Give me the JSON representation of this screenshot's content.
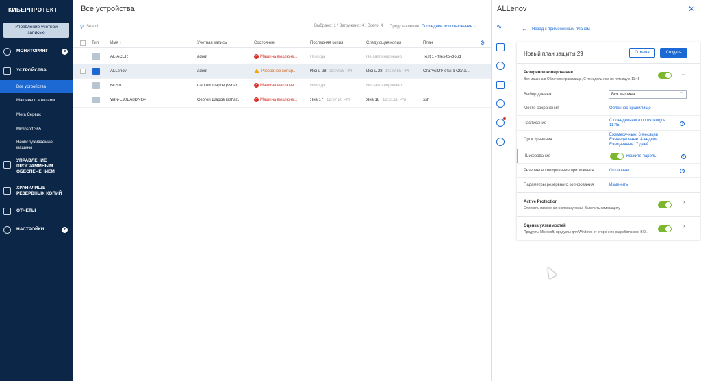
{
  "sidebar": {
    "logo": "КИБЕРПРОТЕКТ",
    "account_button": "Управление учетной\nзаписью",
    "nav": [
      {
        "label": "МОНИТОРИНГ",
        "badge": "5"
      },
      {
        "label": "УСТРОЙСТВА"
      },
      {
        "label": "УПРАВЛЕНИЕ\nПРОГРАММНЫМ\nОБЕСПЕЧЕНИЕМ"
      },
      {
        "label": "ХРАНИЛИЩЕ\nРЕЗЕРВНЫХ КОПИЙ"
      },
      {
        "label": "ОТЧЕТЫ"
      },
      {
        "label": "НАСТРОЙКИ",
        "badge": "+"
      }
    ],
    "sub_items": [
      {
        "label": "Все устройства"
      },
      {
        "label": "Машины с агентами"
      },
      {
        "label": "Мега Сервис"
      },
      {
        "label": "Microsoft 365"
      },
      {
        "label": "Необслуживаемые\nмашины"
      }
    ]
  },
  "main": {
    "title": "Все устройства",
    "search_placeholder": "Search",
    "counts": "Выбрано: 1 / Загружено: 4 / Всего: 4",
    "view_label": "Представление:",
    "view_value": "Последнее использование ⌄",
    "columns": [
      "Тип",
      "Имя ↑",
      "Учетная запись",
      "Состояние",
      "Последняя копия",
      "Следующая копия",
      "План"
    ],
    "rows": [
      {
        "name": "AL-ACER",
        "account": "adout",
        "status": "Машина выключе...",
        "last": "Никогда",
        "last_time": "",
        "next": "Не запланировано",
        "next_time": "",
        "plan": "Test 1 - files-to-cloud"
      },
      {
        "name": "ALLenov",
        "account": "adout",
        "status": "Резервное копир...",
        "last": "Июнь 28",
        "last_time": "09:09:35 PM",
        "next": "Июнь 28",
        "next_time": "10:23:55 PM",
        "plan": "Статус:Отчёты в Обла..."
      },
      {
        "name": "Bk201",
        "account": "Сергей Шаров (sshar...",
        "status": "Машина выключе...",
        "last": "Никогда",
        "last_time": "",
        "next": "Не запланировано",
        "next_time": "",
        "plan": ""
      },
      {
        "name": "WIN-E90EA8DNGP",
        "account": "Сергей Шаров (sshar...",
        "status": "Машина выключе...",
        "last": "Янв 17",
        "last_time": "12:37:20 PM",
        "next": "Янв 18",
        "next_time": "12:31:28 PM",
        "plan": "ssh"
      }
    ]
  },
  "panel": {
    "title": "ALLenov",
    "back_link": "Назад к примененным планам",
    "plan_name": "Новый план защиты 29",
    "cancel": "Отмена",
    "create": "Создать",
    "backup": {
      "title": "Резервное копирование",
      "subtitle": "Вся машина в Облачное хранилище, С понедельника по пятницу в 11:45"
    },
    "rows": [
      {
        "label": "Выбор данных",
        "value": "Вся машина"
      },
      {
        "label": "Место сохранения",
        "value": "Облачное хранилище"
      },
      {
        "label": "Расписание",
        "value": "С понедельника по пятницу в 11:45"
      },
      {
        "label": "Срок хранения",
        "value": "Ежемесячные: 6 месяцев\nЕженедельные: 4 недели\nЕжедневные: 7 дней"
      },
      {
        "label": "Шифрование",
        "value": "Укажите пароль"
      },
      {
        "label": "Резервное копирование приложения",
        "value": "Отключено"
      },
      {
        "label": "Параметры резервного копирования",
        "value": "Изменить"
      }
    ],
    "active_protection": {
      "title": "Active Protection",
      "subtitle": "Отменить изменения: используя кэш, Включить самозащиту"
    },
    "vulnerability": {
      "title": "Оценка уязвимостей",
      "subtitle": "Продукты Microsoft, продукты для Windows от сторонних разработчиков, В 0..."
    }
  },
  "colors": {
    "sidebar_bg": "#0b2647",
    "accent": "#1c69d4",
    "error": "#d9342b",
    "warning": "#f0a30a",
    "toggle_on": "#7cb82f"
  }
}
